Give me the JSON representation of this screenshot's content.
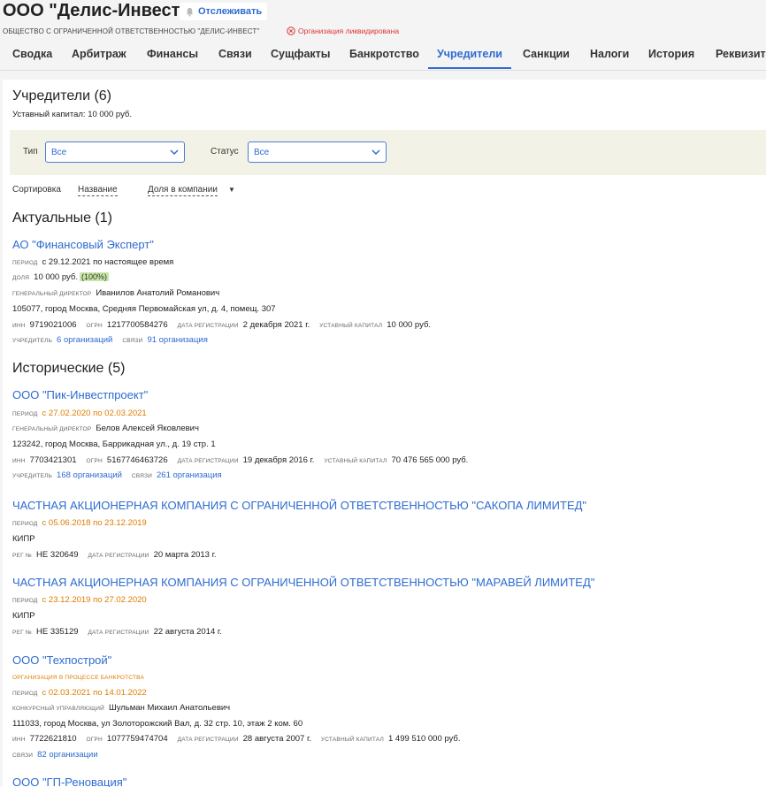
{
  "header": {
    "company_name": "ООО \"Делис-Инвест\"",
    "watch_label": "Отслеживать",
    "full_name": "ОБЩЕСТВО С ОГРАНИЧЕННОЙ ОТВЕТСТВЕННОСТЬЮ \"ДЕЛИС-ИНВЕСТ\"",
    "status": "Организация ликвидирована"
  },
  "tabs": [
    "Сводка",
    "Арбитраж",
    "Финансы",
    "Связи",
    "Сущфакты",
    "Банкротство",
    "Учредители",
    "Санкции",
    "Налоги",
    "История",
    "Реквизиты"
  ],
  "active_tab": "Учредители",
  "founders": {
    "title": "Учредители (6)",
    "capital": "Уставный капитал: 10 000 руб.",
    "filters": {
      "type_label": "Тип",
      "type_value": "Все",
      "status_label": "Статус",
      "status_value": "Все"
    },
    "sort": {
      "label": "Сортировка",
      "by_name": "Название",
      "by_share": "Доля в компании"
    },
    "current_title": "Актуальные (1)",
    "historic_title": "Исторические (5)",
    "current": [
      {
        "name": "АО \"Финансовый Эксперт\"",
        "period_key": "период",
        "period": "с 29.12.2021 по настоящее время",
        "share_key": "доля",
        "share": "10 000 руб.",
        "share_pct": "(100%)",
        "director_key": "генеральный директор",
        "director": "Иванилов Анатолий Романович",
        "address": "105077, город Москва, Средняя Первомайская ул, д. 4, помещ. 307",
        "inn_key": "ИНН",
        "inn": "9719021006",
        "ogrn_key": "ОГРН",
        "ogrn": "1217700584276",
        "reg_key": "дата регистрации",
        "reg_date": "2 декабря 2021 г.",
        "cap_key": "уставный капитал",
        "capital": "10 000 руб.",
        "founder_key": "учредитель",
        "founder_of": "6 организаций",
        "links_key": "связи",
        "links": "91 организация"
      }
    ],
    "historic": [
      {
        "name": "ООО \"Пик-Инвестпроект\"",
        "period_key": "период",
        "period": "с 27.02.2020 по 02.03.2021",
        "director_key": "генеральный директор",
        "director": "Белов Алексей Яковлевич",
        "address": "123242, город Москва, Баррикадная ул., д. 19 стр. 1",
        "inn_key": "ИНН",
        "inn": "7703421301",
        "ogrn_key": "ОГРН",
        "ogrn": "5167746463726",
        "reg_key": "дата регистрации",
        "reg_date": "19 декабря 2016 г.",
        "cap_key": "уставный капитал",
        "capital": "70 476 565 000 руб.",
        "founder_key": "учредитель",
        "founder_of": "168 организаций",
        "links_key": "связи",
        "links": "261 организация"
      },
      {
        "name": "ЧАСТНАЯ АКЦИОНЕРНАЯ КОМПАНИЯ С ОГРАНИЧЕННОЙ ОТВЕТСТВЕННОСТЬЮ \"САКОПА ЛИМИТЕД\"",
        "period_key": "период",
        "period": "с 05.06.2018 по 23.12.2019",
        "country": "КИПР",
        "regno_key": "РЕГ №",
        "regno": "НЕ 320649",
        "reg_key": "дата регистрации",
        "reg_date": "20 марта 2013 г."
      },
      {
        "name": "ЧАСТНАЯ АКЦИОНЕРНАЯ КОМПАНИЯ С ОГРАНИЧЕННОЙ ОТВЕТСТВЕННОСТЬЮ \"МАРАВЕЙ ЛИМИТЕД\"",
        "period_key": "период",
        "period": "с 23.12.2019 по 27.02.2020",
        "country": "КИПР",
        "regno_key": "РЕГ №",
        "regno": "НЕ 335129",
        "reg_key": "дата регистрации",
        "reg_date": "22 августа 2014 г."
      },
      {
        "name": "ООО \"Техпострой\"",
        "note": "организация в процессе банкротства",
        "period_key": "период",
        "period": "с 02.03.2021 по 14.01.2022",
        "director_key": "конкурсный управляющий",
        "director": "Шульман Михаил Анатольевич",
        "address": "111033, город Москва, ул Золоторожский Вал, д. 32 стр. 10, этаж 2 ком. 60",
        "inn_key": "ИНН",
        "inn": "7722621810",
        "ogrn_key": "ОГРН",
        "ogrn": "1077759474704",
        "reg_key": "дата регистрации",
        "reg_date": "28 августа 2007 г.",
        "cap_key": "уставный капитал",
        "capital": "1 499 510 000 руб.",
        "links_key": "связи",
        "links": "82 организации"
      },
      {
        "name": "ООО \"ГП-Реновация\""
      }
    ]
  }
}
